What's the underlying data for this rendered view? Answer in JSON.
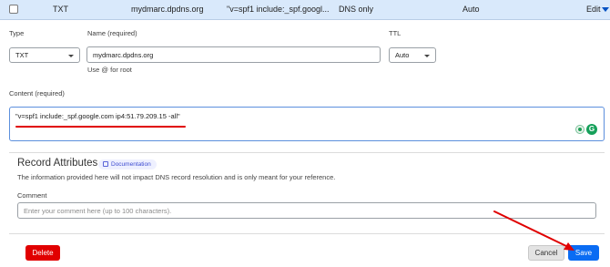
{
  "record_row": {
    "type": "TXT",
    "name": "mydmarc.dpdns.org",
    "content_preview": "\"v=spf1 include:_spf.googl...",
    "proxy_status": "DNS only",
    "ttl": "Auto",
    "edit_label": "Edit"
  },
  "form": {
    "type_label": "Type",
    "type_value": "TXT",
    "name_label": "Name (required)",
    "name_value": "mydmarc.dpdns.org",
    "name_helper": "Use @ for root",
    "ttl_label": "TTL",
    "ttl_value": "Auto",
    "content_label": "Content (required)",
    "content_value": "\"v=spf1 include:_spf.google.com ip4:51.79.209.15 -all\""
  },
  "record_attributes": {
    "title": "Record Attributes",
    "doc_badge": "Documentation",
    "info": "The information provided here will not impact DNS record resolution and is only meant for your reference.",
    "comment_label": "Comment",
    "comment_placeholder": "Enter your comment here (up to 100 characters)."
  },
  "actions": {
    "delete_label": "Delete",
    "cancel_label": "Cancel",
    "save_label": "Save"
  },
  "colors": {
    "row_highlight": "#d9e9fb",
    "primary": "#0a6cf3",
    "danger": "#e10000",
    "annotation": "#e00000"
  }
}
